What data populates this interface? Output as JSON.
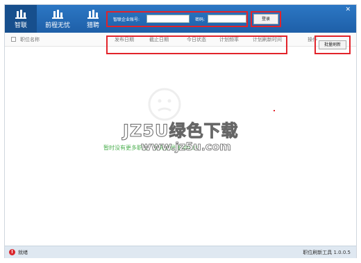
{
  "nav": [
    {
      "label": "智联",
      "icon": "building-icon"
    },
    {
      "label": "前程无忧",
      "icon": "building-icon"
    },
    {
      "label": "猎聘",
      "icon": "building-icon"
    }
  ],
  "login": {
    "account_label": "智联企业账号:",
    "account_value": "",
    "password_label": "密码:",
    "password_value": "",
    "button_label": "登录"
  },
  "table": {
    "headers": {
      "name": "职位名称",
      "publish_date": "发布日期",
      "end_date": "截止日期",
      "today_status": "今日状态",
      "plan_freq": "计划频率",
      "plan_time": "计划刷新时间",
      "action": "操作"
    },
    "batch_button": "批量刷新"
  },
  "empty": {
    "message": "暂时没有更多职位，请先登录账号信息"
  },
  "watermark": {
    "line1": "JZ5U绿色下载",
    "line2": "www.jz5u.com"
  },
  "status": {
    "text": "就绪",
    "version": "职位刷新工具 1.0.0.5"
  },
  "colors": {
    "header_blue": "#2c77c4",
    "highlight_red": "#e2232a",
    "empty_green": "#4caf50"
  }
}
